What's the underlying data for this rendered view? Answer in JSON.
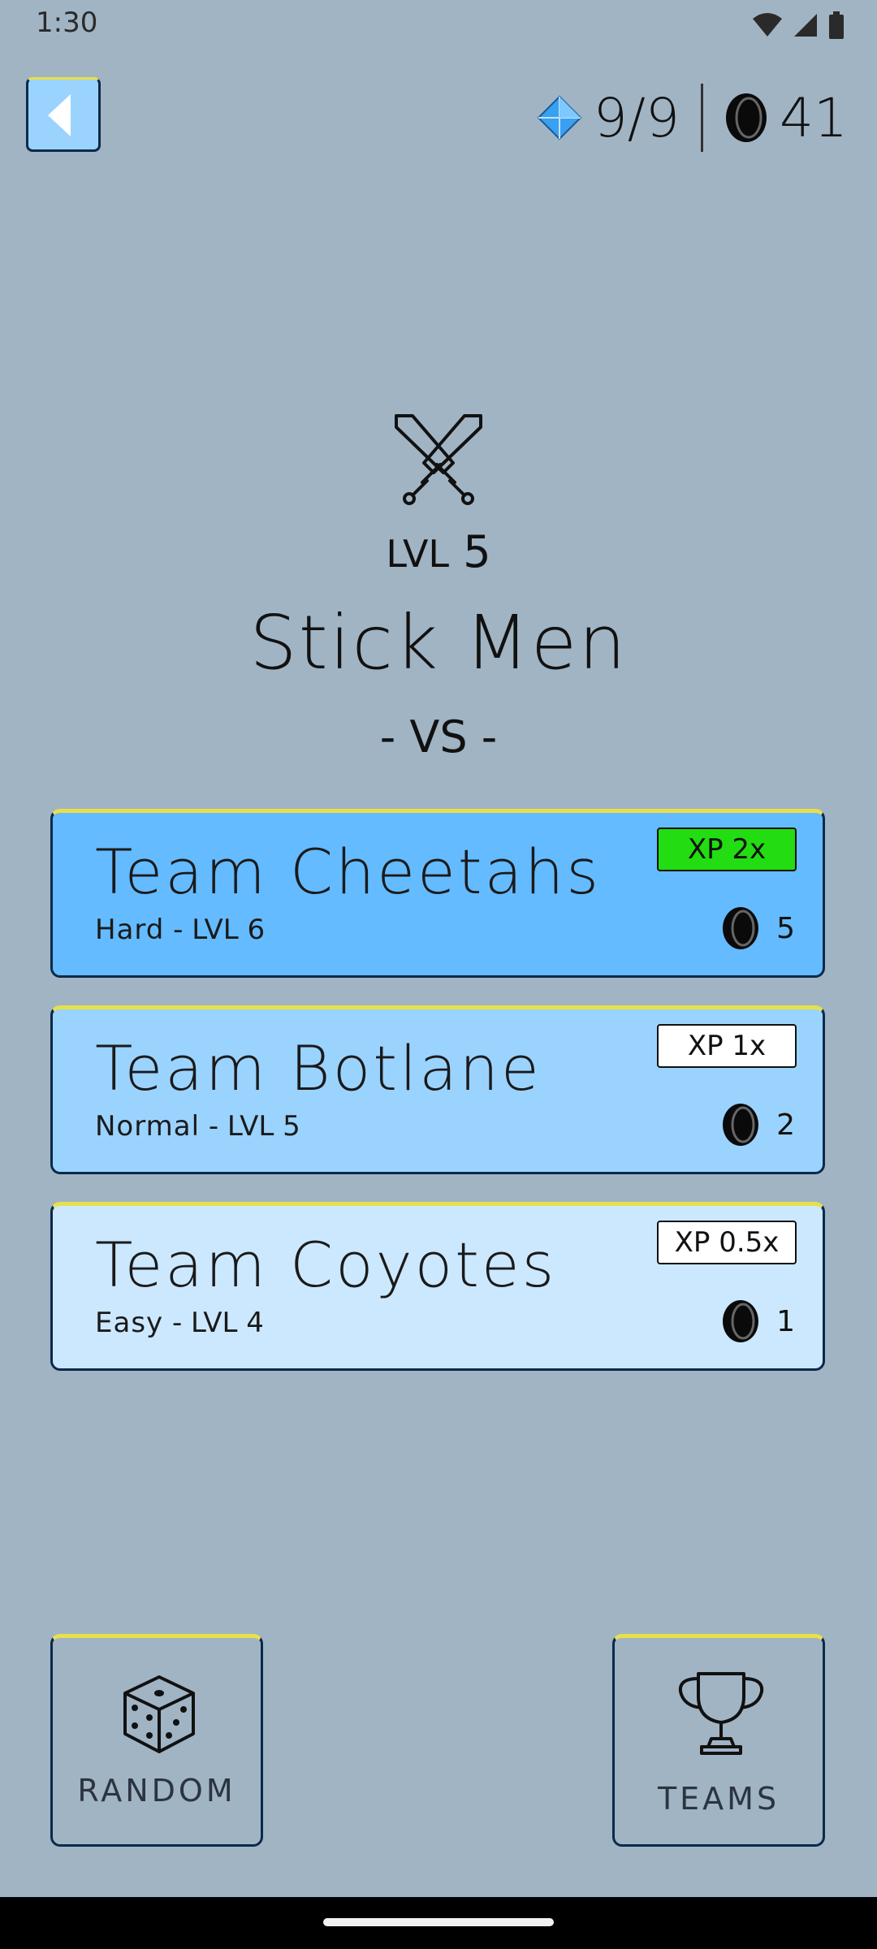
{
  "status_bar": {
    "time": "1:30"
  },
  "resources": {
    "gems": "9/9",
    "coins": "41"
  },
  "match": {
    "level_prefix": "LVL",
    "level_value": "5",
    "player_name": "Stick Men",
    "vs_label": "- VS -"
  },
  "teams": [
    {
      "name": "Team Cheetahs",
      "difficulty": "Hard",
      "sep": " - ",
      "level": "LVL 6",
      "xp": "XP 2x",
      "reward": "5",
      "card_color": "#64bbff",
      "xp_color": "#22dd11"
    },
    {
      "name": "Team Botlane",
      "difficulty": "Normal",
      "sep": " - ",
      "level": "LVL 5",
      "xp": "XP 1x",
      "reward": "2",
      "card_color": "#9bd3ff",
      "xp_color": "#ffffff"
    },
    {
      "name": "Team Coyotes",
      "difficulty": "Easy",
      "sep": " - ",
      "level": "LVL 4",
      "xp": "XP 0.5x",
      "reward": "1",
      "card_color": "#cce8ff",
      "xp_color": "#ffffff"
    }
  ],
  "buttons": {
    "random": "RANDOM",
    "teams": "TEAMS"
  },
  "icons": [
    "wifi-icon",
    "signal-icon",
    "battery-icon",
    "back-icon",
    "gem-icon",
    "coin-icon",
    "crossed-swords-icon",
    "dice-icon",
    "trophy-icon"
  ]
}
